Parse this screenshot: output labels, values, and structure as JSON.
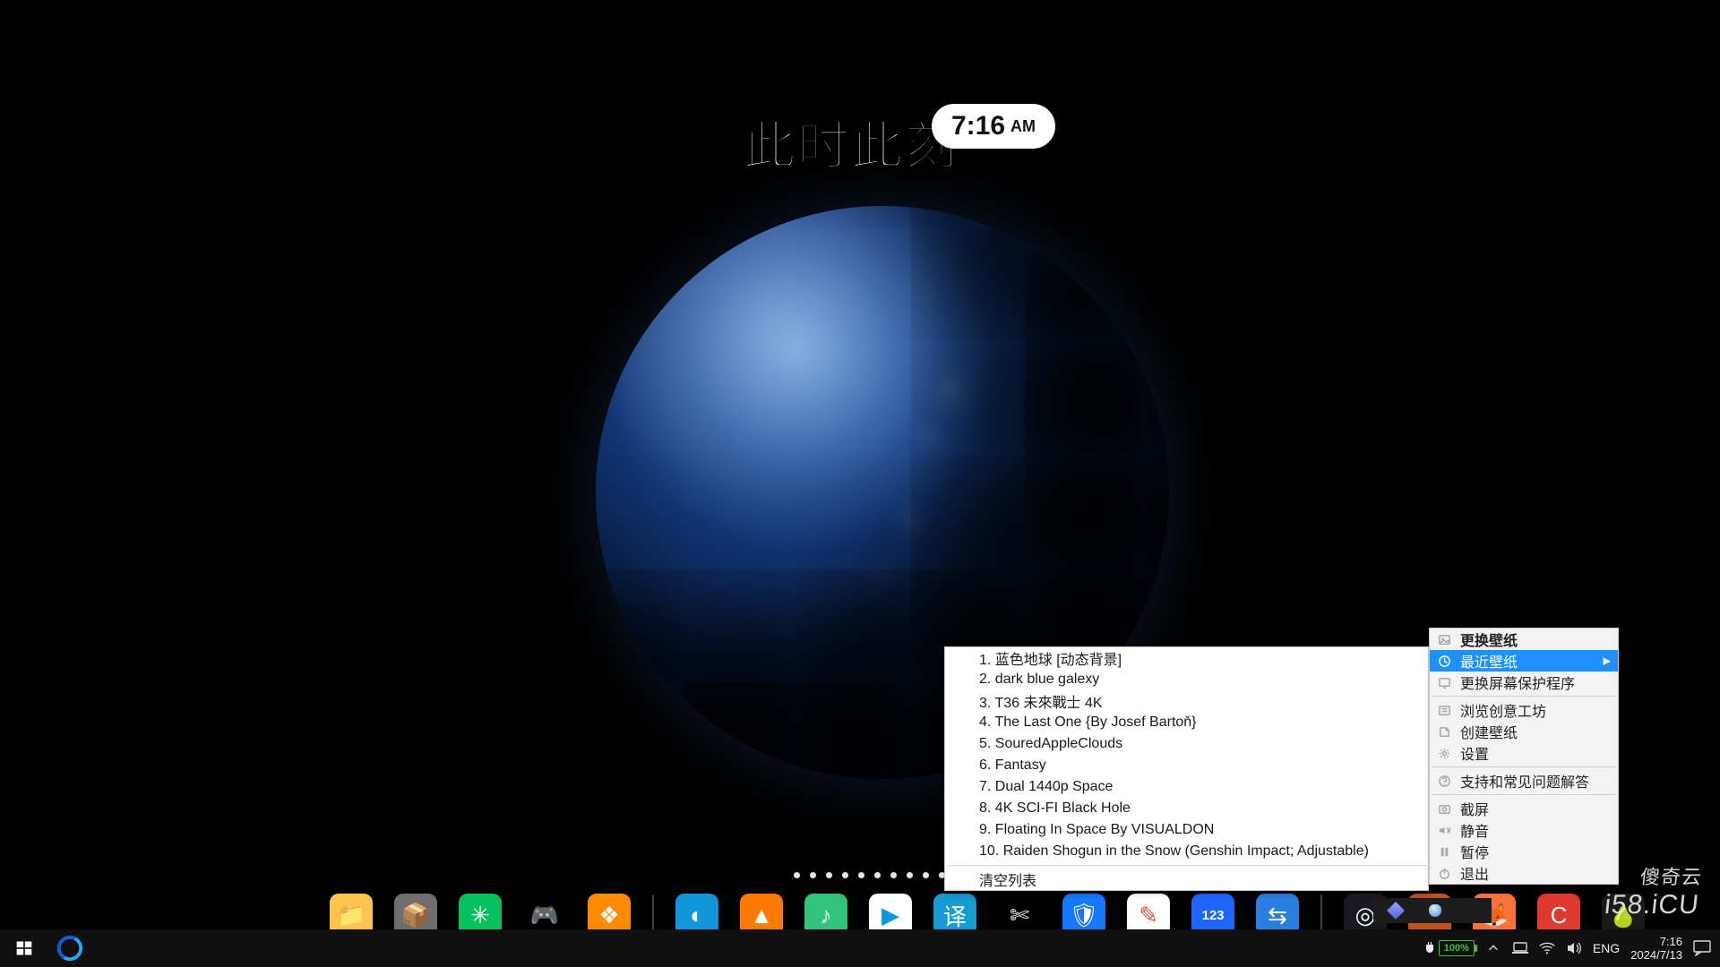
{
  "wallpaper_widget": {
    "title": "此时此刻",
    "time": "7:16",
    "ampm": "AM"
  },
  "context_menu": {
    "items": [
      {
        "label": "更换壁纸",
        "icon": "image-icon",
        "bold": true
      },
      {
        "label": "最近壁纸",
        "icon": "recent-icon",
        "submenu": true,
        "hover": true
      },
      {
        "label": "更换屏幕保护程序",
        "icon": "screensaver-icon"
      },
      {
        "label": "浏览创意工坊",
        "icon": "workshop-icon",
        "sep_before": true
      },
      {
        "label": "创建壁纸",
        "icon": "create-icon"
      },
      {
        "label": "设置",
        "icon": "settings-icon"
      },
      {
        "label": "支持和常见问题解答",
        "icon": "help-icon",
        "sep_before": true
      },
      {
        "label": "截屏",
        "icon": "screenshot-icon",
        "sep_before": true
      },
      {
        "label": "静音",
        "icon": "mute-icon"
      },
      {
        "label": "暂停",
        "icon": "pause-icon"
      },
      {
        "label": "退出",
        "icon": "power-icon"
      }
    ]
  },
  "recent_wallpapers": {
    "items": [
      "1. 蓝色地球 [动态背景]",
      "2. dark blue galexy",
      "3. T36 未來戰士 4K",
      "4. The Last One {By Josef Bartoň}",
      "5. SouredAppleClouds",
      "6. Fantasy",
      "7. Dual 1440p Space",
      "8. 4K SCI-FI Black Hole",
      "9. Floating In Space By VISUALDON",
      "10. Raiden Shogun in the Snow (Genshin Impact; Adjustable)"
    ],
    "clear_label": "清空列表"
  },
  "dock": {
    "apps_left": [
      {
        "name": "file-explorer",
        "color": "#ffc44d",
        "glyph": "📁"
      },
      {
        "name": "archive-app",
        "color": "#6e6e6e",
        "glyph": "📦"
      },
      {
        "name": "wechat",
        "color": "#07c160",
        "glyph": "✳"
      },
      {
        "name": "game-center",
        "color": "#000000",
        "glyph": "🎮"
      },
      {
        "name": "ali-app",
        "color": "#ff8a00",
        "glyph": "❖"
      }
    ],
    "apps_mid": [
      {
        "name": "qq-browser",
        "color": "#1296db",
        "glyph": "◐"
      },
      {
        "name": "uc-app",
        "color": "#ff7a00",
        "glyph": "▲"
      },
      {
        "name": "qq-music",
        "color": "#31c27c",
        "glyph": "♪"
      },
      {
        "name": "tencent-docs",
        "color": "#ffffff",
        "glyph": "▶",
        "fg": "#1296db"
      },
      {
        "name": "translate-app",
        "color": "#169bd5",
        "glyph": "译"
      },
      {
        "name": "capcut",
        "color": "#000000",
        "glyph": "✄"
      },
      {
        "name": "tencent-guard",
        "color": "#1677ff",
        "glyph": "🛡"
      },
      {
        "name": "notes-app",
        "color": "#ffffff",
        "glyph": "✎",
        "fg": "#e74c3c"
      },
      {
        "name": "123pan",
        "color": "#1e66ff",
        "glyph": "123"
      },
      {
        "name": "todesk",
        "color": "#2a7de1",
        "glyph": "⇆"
      }
    ],
    "apps_right": [
      {
        "name": "steam",
        "color": "#171a21",
        "glyph": "◎"
      },
      {
        "name": "wukong",
        "color": "#c0521a",
        "glyph": "✦"
      },
      {
        "name": "firefox",
        "color": "#ff7139",
        "glyph": "🦊"
      },
      {
        "name": "app-red",
        "color": "#e03a2f",
        "glyph": "C"
      },
      {
        "name": "pear-app",
        "color": "#1a1a1a",
        "glyph": "🍐"
      }
    ]
  },
  "taskbar": {
    "battery_pct": "100%",
    "lang": "ENG",
    "time": "7:16",
    "date": "2024/7/13"
  },
  "watermark": {
    "cn": "傻奇云",
    "en": "i58.iCU"
  }
}
